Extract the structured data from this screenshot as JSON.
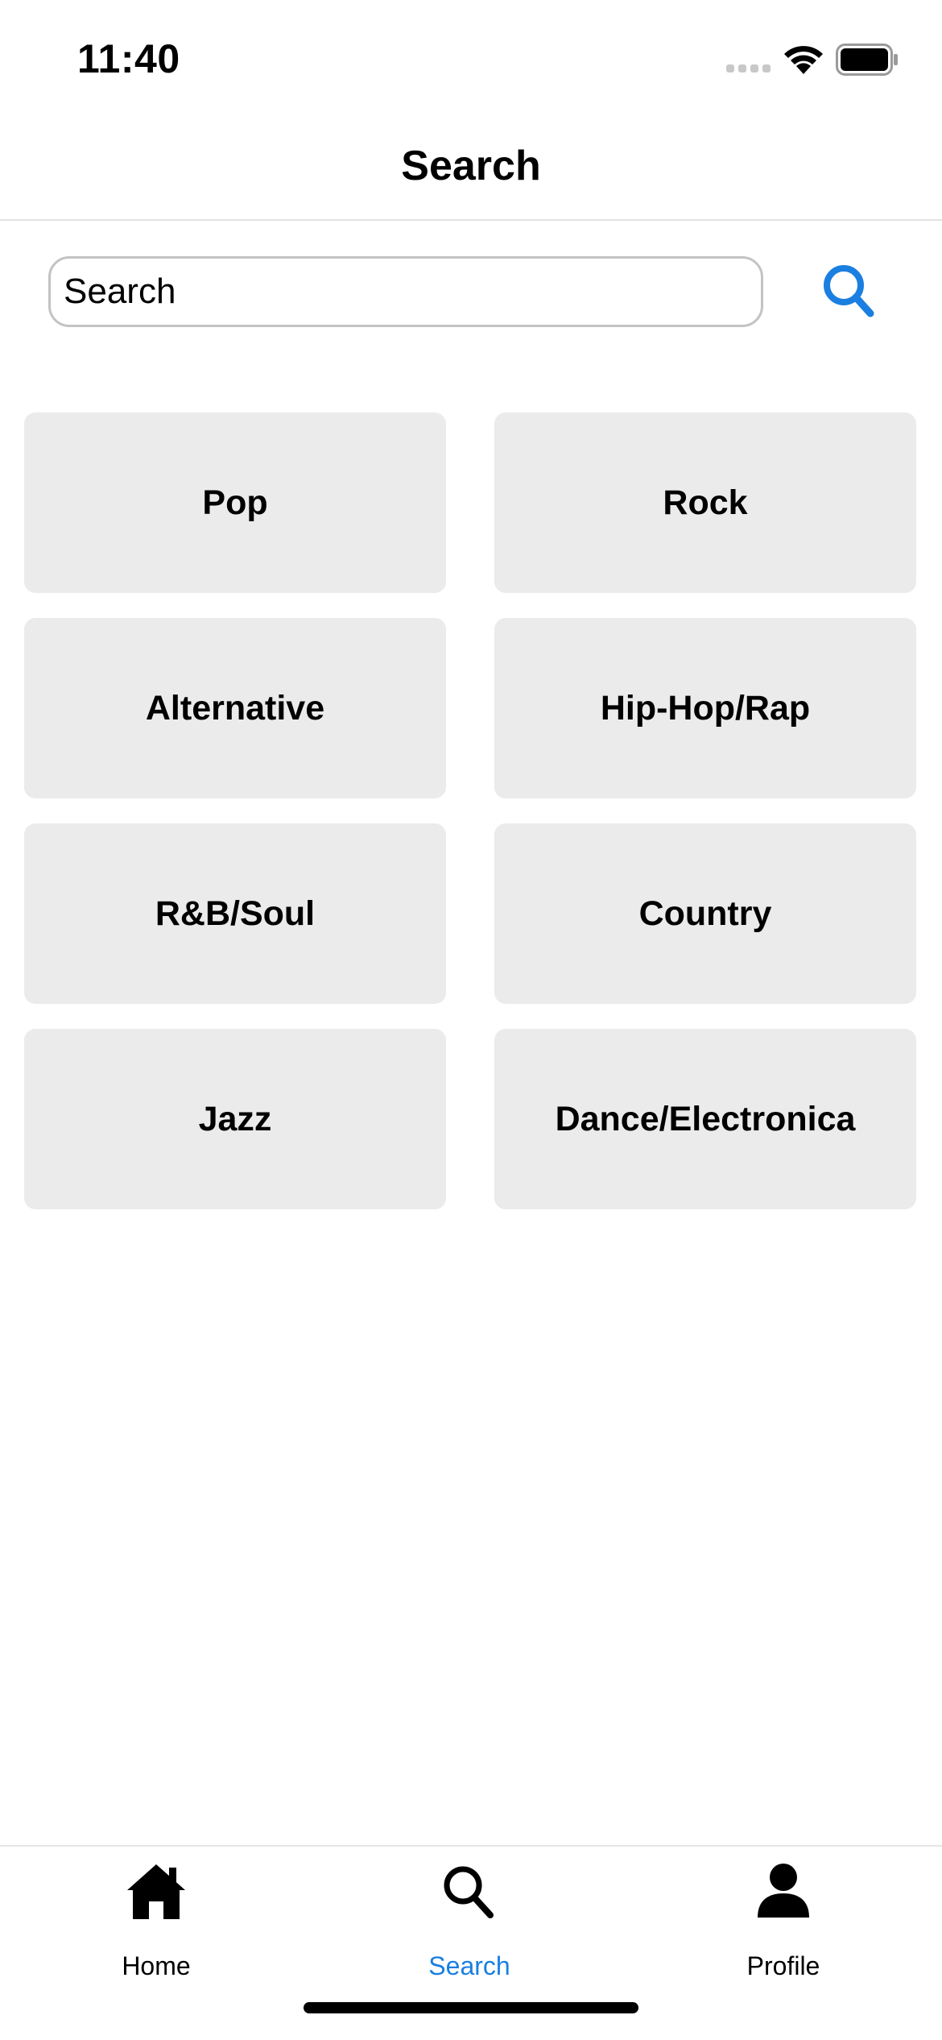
{
  "status_bar": {
    "time": "11:40",
    "icons": [
      "signal-icon",
      "wifi-icon",
      "battery-icon"
    ]
  },
  "header": {
    "title": "Search"
  },
  "search": {
    "placeholder": "Search",
    "value": "",
    "button_icon": "search-icon"
  },
  "genres": [
    {
      "label": "Pop"
    },
    {
      "label": "Rock"
    },
    {
      "label": "Alternative"
    },
    {
      "label": "Hip-Hop/Rap"
    },
    {
      "label": "R&B/Soul"
    },
    {
      "label": "Country"
    },
    {
      "label": "Jazz"
    },
    {
      "label": "Dance/Electronica"
    }
  ],
  "tab_bar": {
    "tabs": [
      {
        "label": "Home",
        "icon": "home-icon",
        "active": false
      },
      {
        "label": "Search",
        "icon": "search-icon",
        "active": true
      },
      {
        "label": "Profile",
        "icon": "person-icon",
        "active": false
      }
    ]
  },
  "colors": {
    "accent": "#1a7fe0",
    "tile_background": "#ebebeb",
    "text": "#000000"
  }
}
